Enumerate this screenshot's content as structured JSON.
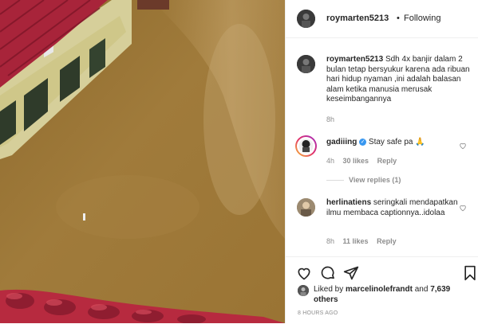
{
  "post": {
    "username": "roymarten5213",
    "follow_status": "Following",
    "separator": "•",
    "caption": "Sdh 4x banjir dalam 2 bulan tetap bersyukur karena ada ribuan hari hidup nyaman ,ini adalah balasan alam ketika manusia merusak keseimbangannya",
    "caption_time": "8h"
  },
  "comments": [
    {
      "username": "gadiiing",
      "verified": true,
      "text": "Stay safe pa 🙏",
      "time": "4h",
      "likes": "30 likes",
      "reply": "Reply",
      "view_replies": "View replies (1)"
    },
    {
      "username": "herlinatiens",
      "text": "seringkali mendapatkan ilmu membaca captionnya..idolaa",
      "time": "8h",
      "likes": "11 likes",
      "reply": "Reply"
    }
  ],
  "likes": {
    "prefix": "Liked by",
    "user": "marcelinolefrandt",
    "and": "and",
    "count": "7,639 others"
  },
  "timestamp": "8 HOURS AGO",
  "icons": {
    "like": "heart-icon",
    "comment": "comment-icon",
    "share": "share-icon",
    "save": "bookmark-icon"
  }
}
